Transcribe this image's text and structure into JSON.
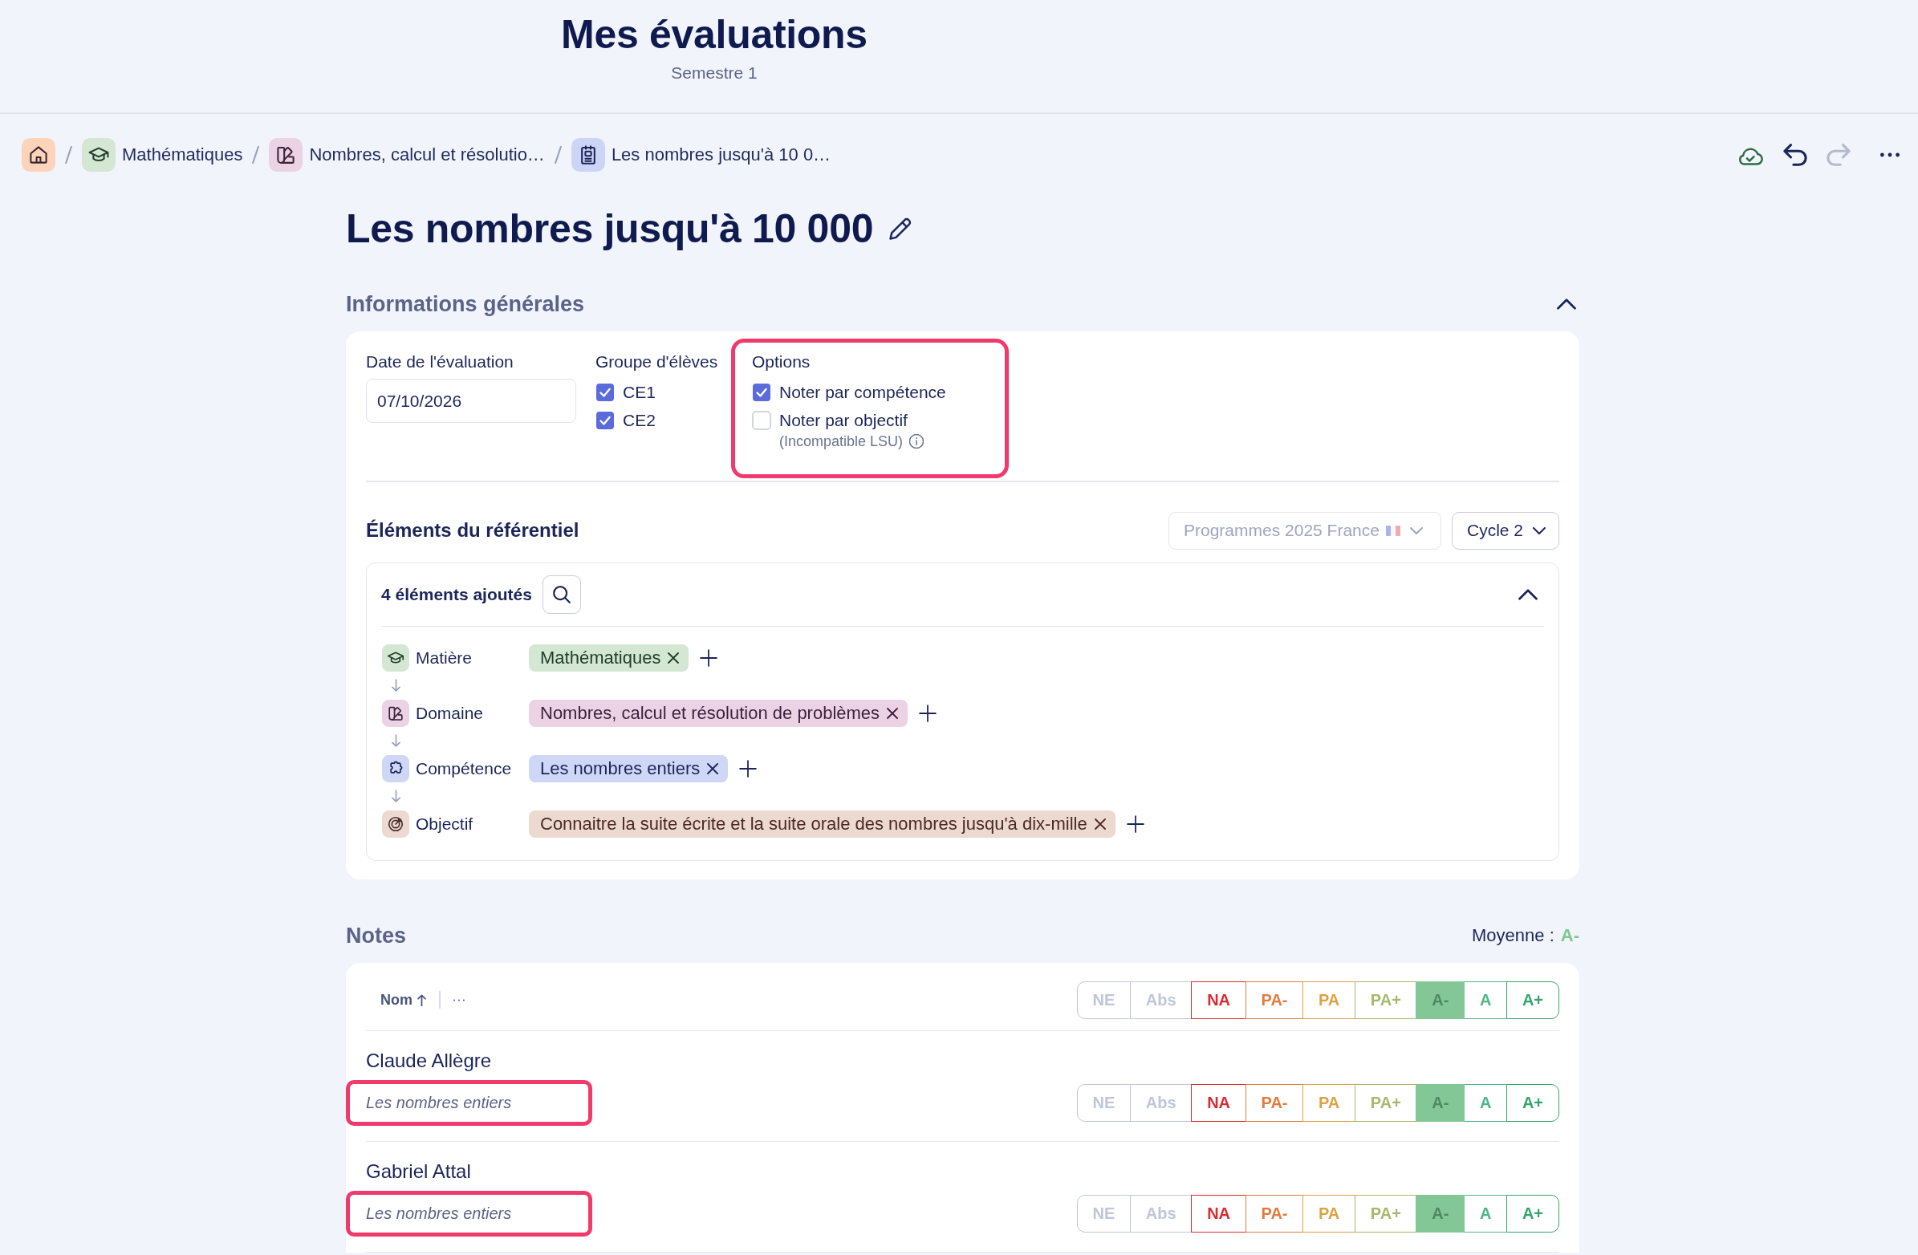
{
  "header": {
    "title": "Mes évaluations",
    "subtitle": "Semestre 1"
  },
  "breadcrumb": [
    {
      "kind": "home"
    },
    {
      "kind": "subject",
      "label": "Mathématiques"
    },
    {
      "kind": "domain",
      "label": "Nombres, calcul et résolutio…"
    },
    {
      "kind": "evaluation",
      "label": "Les nombres jusqu'à 10 0…"
    }
  ],
  "history": {
    "undo": {
      "disabled": false
    },
    "redo": {
      "disabled": true
    }
  },
  "page_title": "Les nombres jusqu'à 10 000",
  "general_info": {
    "title": "Informations générales",
    "expanded": true,
    "date": {
      "label": "Date de l'évaluation",
      "value": "07/10/2026"
    },
    "groups": {
      "label": "Groupe d'élèves",
      "items": [
        {
          "label": "CE1",
          "checked": true
        },
        {
          "label": "CE2",
          "checked": true
        }
      ]
    },
    "options": {
      "label": "Options",
      "highlighted": true,
      "items": [
        {
          "label": "Noter par compétence",
          "checked": true
        },
        {
          "label": "Noter par objectif",
          "checked": false,
          "note": "(Incompatible LSU)"
        }
      ]
    },
    "framework": {
      "title": "Éléments du référentiel",
      "dropdowns": [
        {
          "kind": "flagged",
          "value": "Programmes 2025 France",
          "disabled": true
        },
        {
          "kind": "plain",
          "value": "Cycle 2",
          "disabled": false
        }
      ],
      "count_label": "4 éléments ajoutés",
      "expanded": true,
      "rows": [
        {
          "kind": "subject",
          "label": "Matière",
          "tags": [
            "Mathématiques"
          ]
        },
        {
          "kind": "domain",
          "label": "Domaine",
          "tags": [
            "Nombres, calcul et résolution de problèmes"
          ]
        },
        {
          "kind": "competence",
          "label": "Compétence",
          "tags": [
            "Les nombres entiers"
          ]
        },
        {
          "kind": "objective",
          "label": "Objectif",
          "tags": [
            "Connaitre la suite écrite et la suite orale des nombres jusqu'à dix-mille"
          ]
        }
      ]
    }
  },
  "notes": {
    "title": "Notes",
    "average": {
      "label": "Moyenne :",
      "value": "A-"
    },
    "sort": {
      "label": "Nom",
      "ascending": true
    },
    "bulk_grades": [
      {
        "label": "NE",
        "color": "#bfc5db",
        "selected": false
      },
      {
        "label": "Abs",
        "color": "#bfc5db",
        "selected": false
      },
      {
        "label": "NA",
        "color": "#d92b32",
        "selected": false
      },
      {
        "label": "PA-",
        "color": "#e27b3b",
        "selected": false
      },
      {
        "label": "PA",
        "color": "#dba343",
        "selected": false
      },
      {
        "label": "PA+",
        "color": "#a7b96b",
        "selected": false
      },
      {
        "label": "A-",
        "color": "#84c796",
        "selected": true
      },
      {
        "label": "A",
        "color": "#4bb784",
        "selected": false
      },
      {
        "label": "A+",
        "color": "#33a56b",
        "selected": false
      }
    ],
    "students": [
      {
        "name": "Claude Allègre",
        "competence": "Les nombres entiers",
        "highlighted": true,
        "grades": [
          {
            "label": "NE",
            "color": "#bfc5db",
            "selected": false
          },
          {
            "label": "Abs",
            "color": "#bfc5db",
            "selected": false
          },
          {
            "label": "NA",
            "color": "#d92b32",
            "selected": false
          },
          {
            "label": "PA-",
            "color": "#e27b3b",
            "selected": false
          },
          {
            "label": "PA",
            "color": "#dba343",
            "selected": false
          },
          {
            "label": "PA+",
            "color": "#a7b96b",
            "selected": false
          },
          {
            "label": "A-",
            "color": "#84c796",
            "selected": true
          },
          {
            "label": "A",
            "color": "#4bb784",
            "selected": false
          },
          {
            "label": "A+",
            "color": "#33a56b",
            "selected": false
          }
        ]
      },
      {
        "name": "Gabriel Attal",
        "competence": "Les nombres entiers",
        "highlighted": true,
        "grades": [
          {
            "label": "NE",
            "color": "#bfc5db",
            "selected": false
          },
          {
            "label": "Abs",
            "color": "#bfc5db",
            "selected": false
          },
          {
            "label": "NA",
            "color": "#d92b32",
            "selected": false
          },
          {
            "label": "PA-",
            "color": "#e27b3b",
            "selected": false
          },
          {
            "label": "PA",
            "color": "#dba343",
            "selected": false
          },
          {
            "label": "PA+",
            "color": "#a7b96b",
            "selected": false
          },
          {
            "label": "A-",
            "color": "#84c796",
            "selected": true
          },
          {
            "label": "A",
            "color": "#4bb784",
            "selected": false
          },
          {
            "label": "A+",
            "color": "#33a56b",
            "selected": false
          }
        ]
      }
    ]
  }
}
